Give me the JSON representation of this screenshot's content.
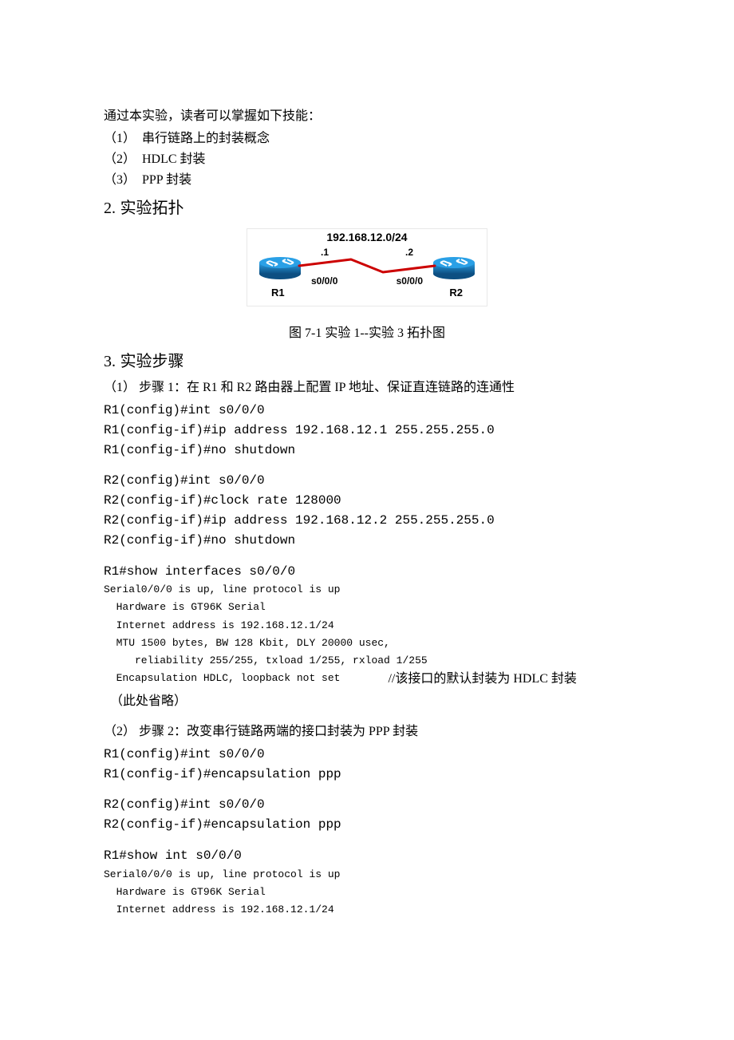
{
  "intro": "通过本实验，读者可以掌握如下技能：",
  "skills": [
    {
      "num": "（1）",
      "text": "串行链路上的封装概念"
    },
    {
      "num": "（2）",
      "text": "HDLC 封装"
    },
    {
      "num": "（3）",
      "text": "PPP 封装"
    }
  ],
  "section2": {
    "num": "2.",
    "title": "实验拓扑"
  },
  "diagram": {
    "network": "192.168.12.0/24",
    "r1": "R1",
    "r2": "R2",
    "h1": ".1",
    "h2": ".2",
    "p1": "s0/0/0",
    "p2": "s0/0/0"
  },
  "figcaption": "图 7-1 实验 1--实验 3 拓扑图",
  "section3": {
    "num": "3.",
    "title": "实验步骤"
  },
  "step1": "（1） 步骤 1：在 R1 和 R2 路由器上配置 IP 地址、保证直连链路的连通性",
  "code_r1_cfg": "R1(config)#int s0/0/0\nR1(config-if)#ip address 192.168.12.1 255.255.255.0\nR1(config-if)#no shutdown",
  "code_r2_cfg": "R2(config)#int s0/0/0\nR2(config-if)#clock rate 128000\nR2(config-if)#ip address 192.168.12.2 255.255.255.0\nR2(config-if)#no shutdown",
  "code_r1_show_cmd": "R1#show interfaces s0/0/0",
  "code_r1_show_out": "Serial0/0/0 is up, line protocol is up\n  Hardware is GT96K Serial\n  Internet address is 192.168.12.1/24\n  MTU 1500 bytes, BW 128 Kbit, DLY 20000 usec,\n     reliability 255/255, txload 1/255, rxload 1/255",
  "code_r1_encap_line": "  Encapsulation HDLC, loopback not set",
  "code_r1_encap_comment": "//该接口的默认封装为 HDLC 封装",
  "omit": "（此处省略）",
  "step2": "（2） 步骤 2：改变串行链路两端的接口封装为 PPP 封装",
  "code_r1_ppp": "R1(config)#int s0/0/0\nR1(config-if)#encapsulation ppp",
  "code_r2_ppp": "R2(config)#int s0/0/0\nR2(config-if)#encapsulation ppp",
  "code_r1_show2_cmd": "R1#show int s0/0/0",
  "code_r1_show2_out": "Serial0/0/0 is up, line protocol is up\n  Hardware is GT96K Serial\n  Internet address is 192.168.12.1/24"
}
